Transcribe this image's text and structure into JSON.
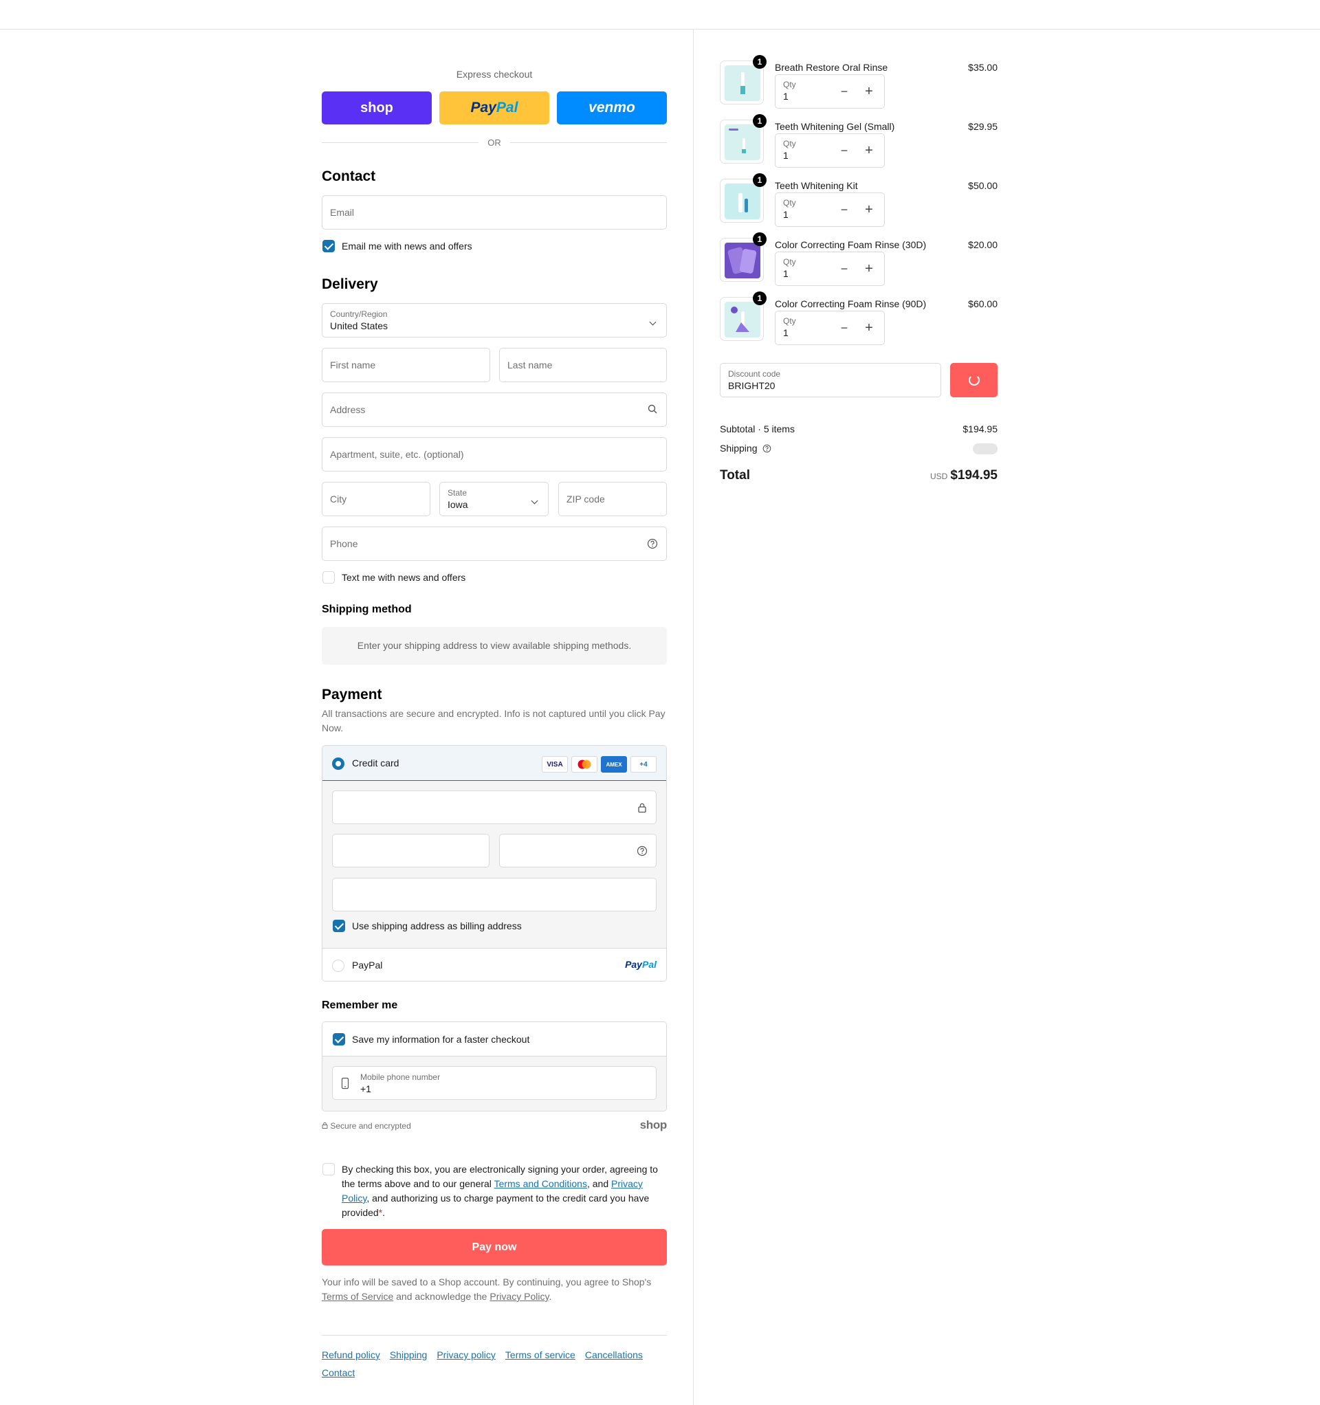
{
  "express": {
    "title": "Express checkout",
    "buttons": {
      "shop": "shop",
      "paypal_a": "Pay",
      "paypal_b": "Pal",
      "venmo": "venmo"
    },
    "or": "OR"
  },
  "contact": {
    "heading": "Contact",
    "email_placeholder": "Email",
    "news_label": "Email me with news and offers",
    "news_checked": true
  },
  "delivery": {
    "heading": "Delivery",
    "country_label": "Country/Region",
    "country_value": "United States",
    "first_name_placeholder": "First name",
    "last_name_placeholder": "Last name",
    "address_placeholder": "Address",
    "apartment_placeholder": "Apartment, suite, etc. (optional)",
    "city_placeholder": "City",
    "state_label": "State",
    "state_value": "Iowa",
    "zip_placeholder": "ZIP code",
    "phone_placeholder": "Phone",
    "text_label": "Text me with news and offers",
    "text_checked": false
  },
  "shipping_method": {
    "heading": "Shipping method",
    "message": "Enter your shipping address to view available shipping methods."
  },
  "payment": {
    "heading": "Payment",
    "note": "All transactions are secure and encrypted. Info is not captured until you click Pay Now.",
    "credit_card_label": "Credit card",
    "card_logos": [
      "VISA",
      "MC",
      "AMEX",
      "+4"
    ],
    "billing_label": "Use shipping address as billing address",
    "billing_checked": true,
    "paypal_label": "PayPal",
    "paypal_logo_a": "Pay",
    "paypal_logo_b": "Pal"
  },
  "remember": {
    "heading": "Remember me",
    "save_label": "Save my information for a faster checkout",
    "save_checked": true,
    "phone_label": "Mobile phone number",
    "phone_value": "+1",
    "secure_text": "Secure and encrypted",
    "shop_logo": "shop"
  },
  "consent": {
    "text_a": "By checking this box, you are electronically signing your order, agreeing to the terms above and to our general ",
    "terms_link": "Terms and Conditions",
    "text_b": ", and ",
    "privacy_link": "Privacy Policy",
    "text_c": ", and authorizing us to charge payment to the credit card you have provided",
    "asterisk": "*",
    "period": "."
  },
  "pay_now": "Pay now",
  "shop_account": {
    "text_a": "Your info will be saved to a Shop account. By continuing, you agree to Shop's ",
    "tos_link": "Terms of Service",
    "text_b": " and acknowledge the ",
    "privacy_link": "Privacy Policy",
    "text_c": "."
  },
  "footer": {
    "links": [
      "Refund policy",
      "Shipping",
      "Privacy policy",
      "Terms of service",
      "Cancellations",
      "Contact"
    ]
  },
  "cart": {
    "qty_label": "Qty",
    "items": [
      {
        "name": "Breath Restore Oral Rinse",
        "price": "$35.00",
        "qty": "1",
        "badge": "1"
      },
      {
        "name": "Teeth Whitening Gel (Small)",
        "price": "$29.95",
        "qty": "1",
        "badge": "1"
      },
      {
        "name": "Teeth Whitening Kit",
        "price": "$50.00",
        "qty": "1",
        "badge": "1"
      },
      {
        "name": "Color Correcting Foam Rinse (30D)",
        "price": "$20.00",
        "qty": "1",
        "badge": "1"
      },
      {
        "name": "Color Correcting Foam Rinse (90D)",
        "price": "$60.00",
        "qty": "1",
        "badge": "1"
      }
    ],
    "discount_label": "Discount code",
    "discount_value": "BRIGHT20",
    "subtotal_label": "Subtotal · 5 items",
    "subtotal_value": "$194.95",
    "shipping_label": "Shipping",
    "total_label": "Total",
    "currency": "USD",
    "total_value": "$194.95"
  },
  "colors": {
    "accent": "#1773b0",
    "pay_button": "#ff5c5c",
    "shop_purple": "#5a31f4",
    "paypal_yellow": "#ffc439",
    "venmo_blue": "#008cff"
  }
}
